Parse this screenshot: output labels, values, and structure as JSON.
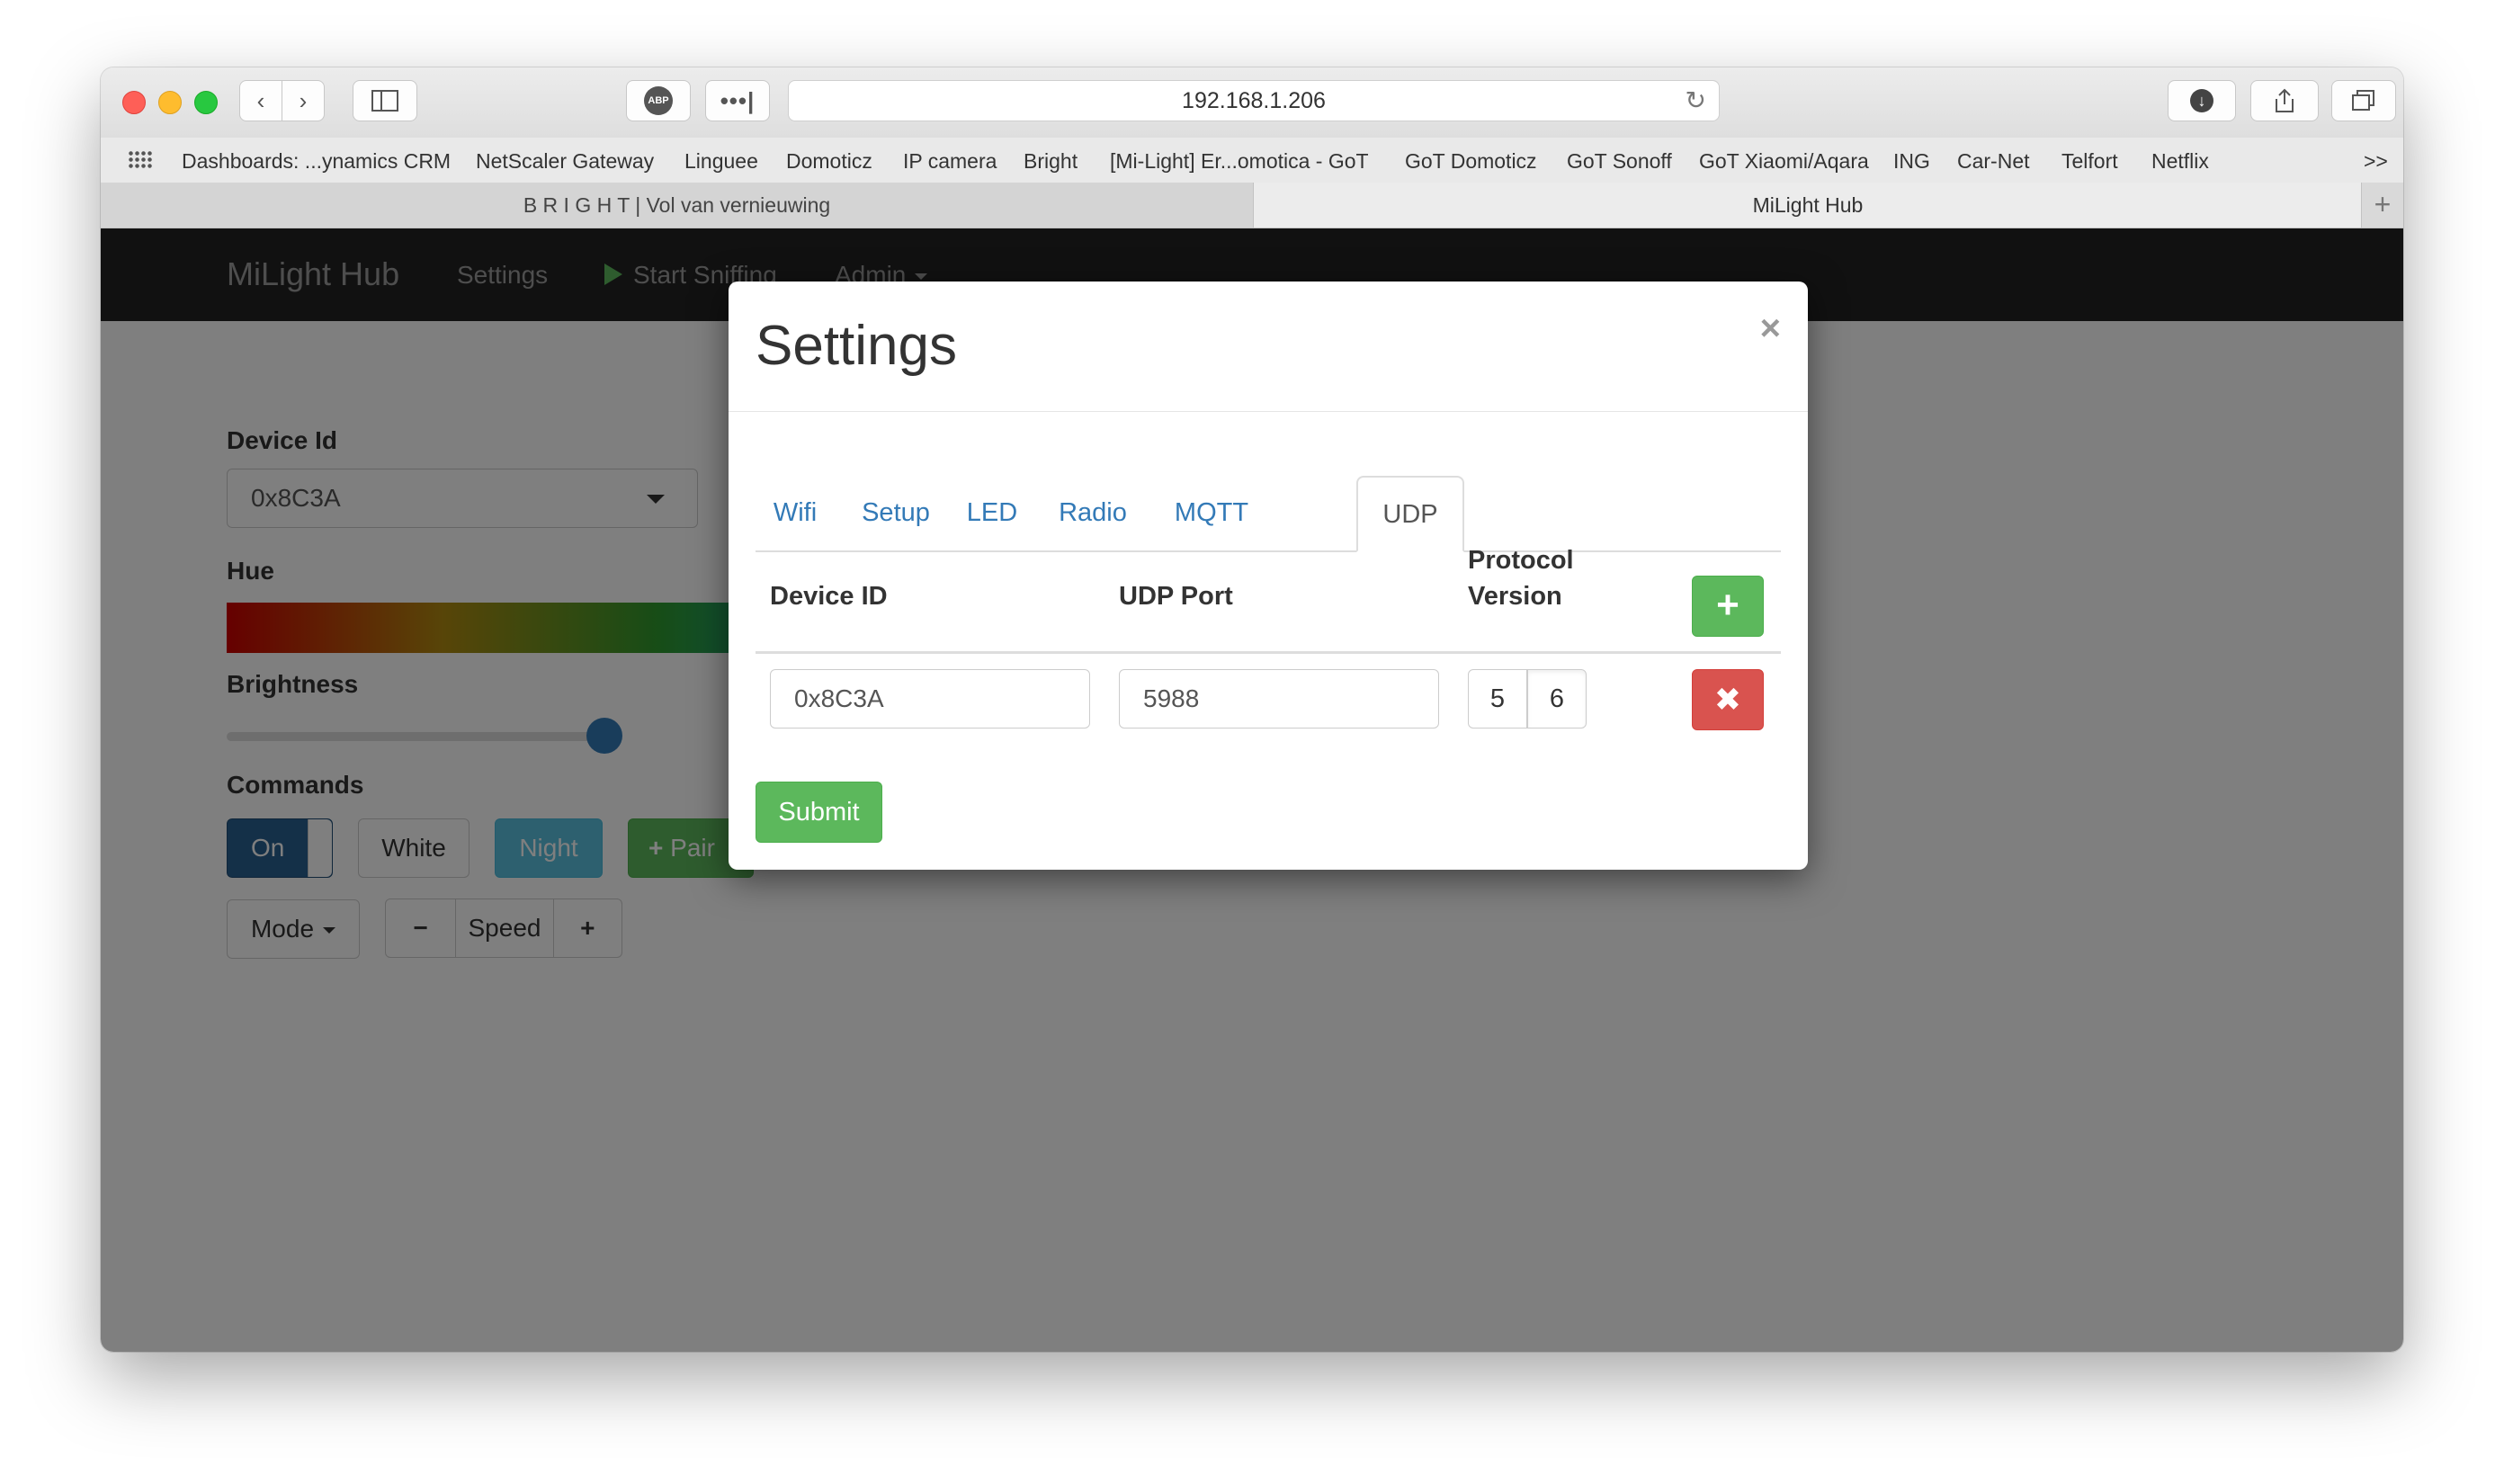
{
  "browser": {
    "url": "192.168.1.206",
    "bookmarks": [
      "Dashboards: ...ynamics CRM",
      "NetScaler Gateway",
      "Linguee",
      "Domoticz",
      "IP camera",
      "Bright",
      "[Mi-Light] Er...omotica - GoT",
      "GoT Domoticz",
      "GoT Sonoff",
      "GoT Xiaomi/Aqara",
      "ING",
      "Car-Net",
      "Telfort",
      "Netflix"
    ],
    "bookmarks_overflow": ">>",
    "tabs": [
      "B R I G H T | Vol van vernieuwing",
      "MiLight Hub"
    ],
    "abp_label": "ABP"
  },
  "navbar": {
    "brand": "MiLight Hub",
    "settings": "Settings",
    "start_sniffing": "Start Sniffing",
    "admin": "Admin"
  },
  "page": {
    "device_id_label": "Device Id",
    "device_id_value": "0x8C3A",
    "hue_label": "Hue",
    "brightness_label": "Brightness",
    "brightness_level": 0.89,
    "commands_label": "Commands",
    "on_label": "On",
    "white_label": "White",
    "night_label": "Night",
    "pair_label": "Pair",
    "mode_label": "Mode",
    "speed_label": "Speed"
  },
  "modal": {
    "title": "Settings",
    "close": "×",
    "tabs": [
      "Wifi",
      "Setup",
      "LED",
      "Radio",
      "MQTT",
      "UDP"
    ],
    "active_tab": "UDP",
    "columns": {
      "device_id": "Device ID",
      "udp_port": "UDP Port",
      "protocol_line1": "Protocol",
      "protocol_line2": "Version"
    },
    "row": {
      "device_id": "0x8C3A",
      "udp_port": "5988",
      "protocol_options": [
        "5",
        "6"
      ],
      "protocol_selected": "6"
    },
    "submit": "Submit"
  },
  "colors": {
    "success": "#5cb85c",
    "danger": "#d9534f",
    "primary": "#337ab7",
    "navbar": "#222222"
  }
}
